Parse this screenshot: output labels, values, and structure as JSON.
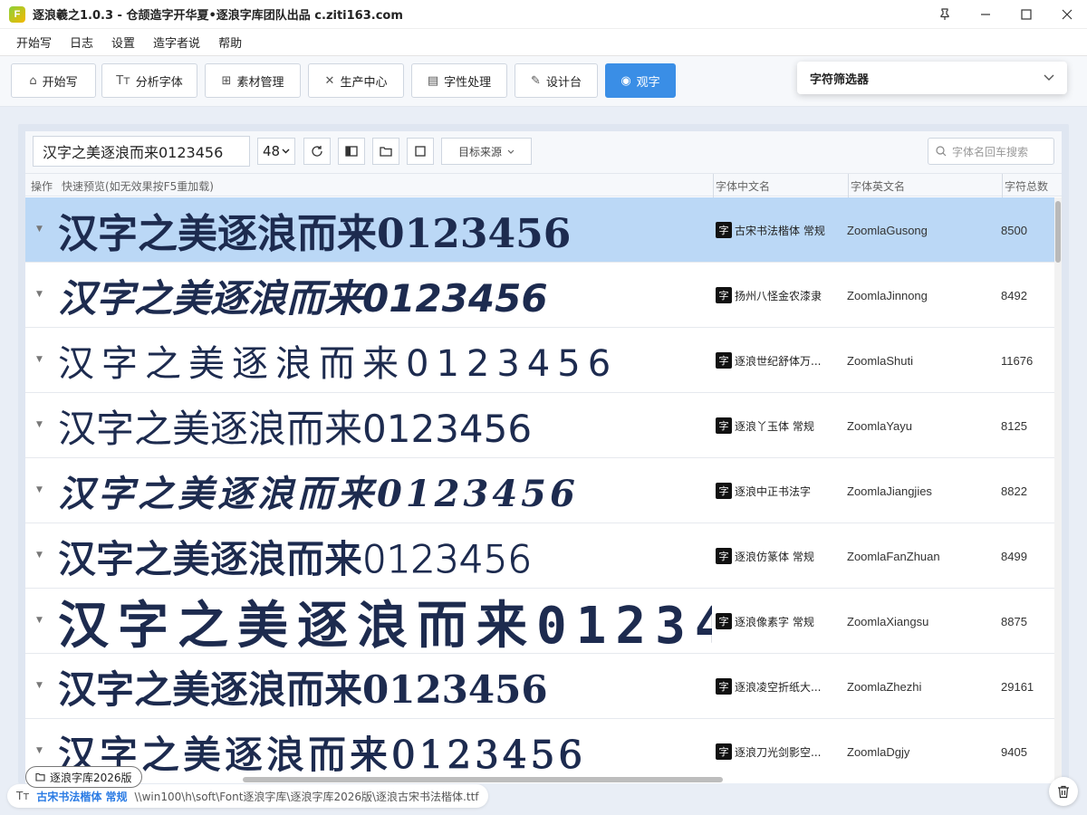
{
  "window": {
    "title": "逐浪羲之1.0.3 - 仓颉造字开华夏•逐浪字库团队出品 c.ziti163.com",
    "app_icon_letter": "F"
  },
  "menu": [
    "开始写",
    "日志",
    "设置",
    "造字者说",
    "帮助"
  ],
  "toolbar": [
    {
      "label": "开始写",
      "icon": "home-icon"
    },
    {
      "label": "分析字体",
      "icon": "font-size-icon"
    },
    {
      "label": "素材管理",
      "icon": "calendar-plus-icon"
    },
    {
      "label": "生产中心",
      "icon": "tools-icon"
    },
    {
      "label": "字性处理",
      "icon": "document-icon"
    },
    {
      "label": "设计台",
      "icon": "design-icon"
    },
    {
      "label": "观字",
      "icon": "view-target-icon",
      "active": true
    }
  ],
  "filter": {
    "label": "字符筛选器"
  },
  "preview": {
    "text": "汉字之美逐浪而来0123456",
    "size": "48",
    "source_label": "目标来源",
    "search_placeholder": "字体名回车搜索"
  },
  "columns": {
    "ops": "操作",
    "quick": "快速预览(如无效果按F5重加载)",
    "cn": "字体中文名",
    "en": "字体英文名",
    "count": "字符总数"
  },
  "fonts": [
    {
      "cn": "古宋书法楷体 常规",
      "en": "ZoomlaGusong",
      "count": "8500",
      "selected": true
    },
    {
      "cn": "扬州八怪金农漆隶",
      "en": "ZoomlaJinnong",
      "count": "8492"
    },
    {
      "cn": "逐浪世纪舒体万...",
      "en": "ZoomlaShuti",
      "count": "11676"
    },
    {
      "cn": "逐浪丫玉体 常规",
      "en": "ZoomlaYayu",
      "count": "8125"
    },
    {
      "cn": "逐浪中正书法字",
      "en": "ZoomlaJiangjies",
      "count": "8822"
    },
    {
      "cn": "逐浪仿篆体 常规",
      "en": "ZoomlaFanZhuan",
      "count": "8499"
    },
    {
      "cn": "逐浪像素字 常规",
      "en": "ZoomlaXiangsu",
      "count": "8875"
    },
    {
      "cn": "逐浪凌空折纸大...",
      "en": "ZoomlaZhezhi",
      "count": "29161"
    },
    {
      "cn": "逐浪刀光剑影空...",
      "en": "ZoomlaDgjy",
      "count": "9405"
    }
  ],
  "badge_char": "字",
  "library_tag": "逐浪字库2026版",
  "status": {
    "font_name": "古宋书法楷体 常规",
    "path": "\\\\win100\\h\\soft\\Font逐浪字库\\逐浪字库2026版\\逐浪古宋书法楷体.ttf"
  },
  "colors": {
    "accent": "#3a8ee6",
    "selected_row": "#bbd8f6",
    "glyph": "#1d2b4f"
  }
}
